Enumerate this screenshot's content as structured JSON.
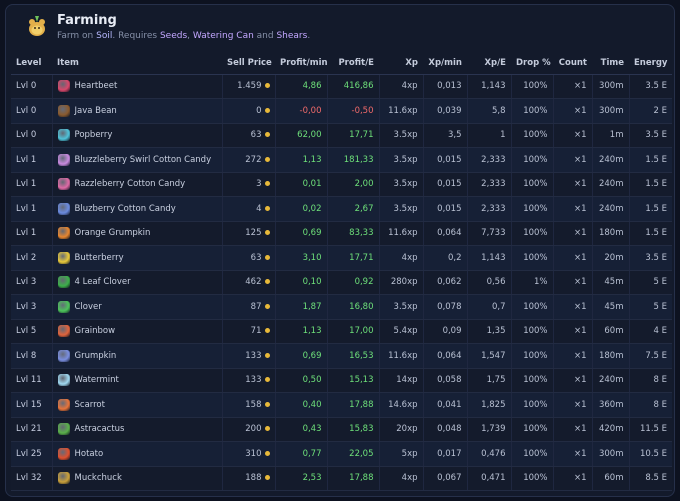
{
  "header": {
    "title": "Farming",
    "subtitle_prefix": "Farm on ",
    "subtitle_location": "Soil",
    "subtitle_requires": ". Requires ",
    "req_1": "Seeds",
    "sep_1": ", ",
    "req_2": "Watering Can",
    "sep_2": " and ",
    "req_3": "Shears",
    "subtitle_end": "."
  },
  "columns": {
    "level": "Level",
    "item": "Item",
    "sell_price": "Sell Price",
    "profit_min": "Profit/min",
    "profit_e": "Profit/E",
    "xp": "Xp",
    "xp_min": "Xp/min",
    "xp_e": "Xp/E",
    "drop": "Drop %",
    "count": "Count",
    "time": "Time",
    "energy": "Energy"
  },
  "rows": [
    {
      "level": "Lvl 0",
      "item": "Heartbeet",
      "icon_color": "#d9476b",
      "sell_price": "1.459",
      "profit_min": "4,86",
      "profit_e": "416,86",
      "xp": "4xp",
      "xp_min": "0,013",
      "xp_e": "1,143",
      "drop": "100%",
      "count": "×1",
      "time": "300m",
      "energy": "3.5 E",
      "profit_sign": "pos"
    },
    {
      "level": "Lvl 0",
      "item": "Java Bean",
      "icon_color": "#8a5a2e",
      "sell_price": "0",
      "profit_min": "-0,00",
      "profit_e": "-0,50",
      "xp": "11.6xp",
      "xp_min": "0,039",
      "xp_e": "5,8",
      "drop": "100%",
      "count": "×1",
      "time": "300m",
      "energy": "2 E",
      "profit_sign": "neg"
    },
    {
      "level": "Lvl 0",
      "item": "Popberry",
      "icon_color": "#4fc3d9",
      "sell_price": "63",
      "profit_min": "62,00",
      "profit_e": "17,71",
      "xp": "3.5xp",
      "xp_min": "3,5",
      "xp_e": "1",
      "drop": "100%",
      "count": "×1",
      "time": "1m",
      "energy": "3.5 E",
      "profit_sign": "pos"
    },
    {
      "level": "Lvl 1",
      "item": "Bluzzleberry Swirl Cotton Candy",
      "icon_color": "#c98ae0",
      "sell_price": "272",
      "profit_min": "1,13",
      "profit_e": "181,33",
      "xp": "3.5xp",
      "xp_min": "0,015",
      "xp_e": "2,333",
      "drop": "100%",
      "count": "×1",
      "time": "240m",
      "energy": "1.5 E",
      "profit_sign": "pos"
    },
    {
      "level": "Lvl 1",
      "item": "Razzleberry Cotton Candy",
      "icon_color": "#e06aa6",
      "sell_price": "3",
      "profit_min": "0,01",
      "profit_e": "2,00",
      "xp": "3.5xp",
      "xp_min": "0,015",
      "xp_e": "2,333",
      "drop": "100%",
      "count": "×1",
      "time": "240m",
      "energy": "1.5 E",
      "profit_sign": "pos"
    },
    {
      "level": "Lvl 1",
      "item": "Bluzberry Cotton Candy",
      "icon_color": "#6b8be0",
      "sell_price": "4",
      "profit_min": "0,02",
      "profit_e": "2,67",
      "xp": "3.5xp",
      "xp_min": "0,015",
      "xp_e": "2,333",
      "drop": "100%",
      "count": "×1",
      "time": "240m",
      "energy": "1.5 E",
      "profit_sign": "pos"
    },
    {
      "level": "Lvl 1",
      "item": "Orange Grumpkin",
      "icon_color": "#e8862e",
      "sell_price": "125",
      "profit_min": "0,69",
      "profit_e": "83,33",
      "xp": "11.6xp",
      "xp_min": "0,064",
      "xp_e": "7,733",
      "drop": "100%",
      "count": "×1",
      "time": "180m",
      "energy": "1.5 E",
      "profit_sign": "pos"
    },
    {
      "level": "Lvl 2",
      "item": "Butterberry",
      "icon_color": "#e8c93a",
      "sell_price": "63",
      "profit_min": "3,10",
      "profit_e": "17,71",
      "xp": "4xp",
      "xp_min": "0,2",
      "xp_e": "1,143",
      "drop": "100%",
      "count": "×1",
      "time": "20m",
      "energy": "3.5 E",
      "profit_sign": "pos"
    },
    {
      "level": "Lvl 3",
      "item": "4 Leaf Clover",
      "icon_color": "#3cb04a",
      "sell_price": "462",
      "profit_min": "0,10",
      "profit_e": "0,92",
      "xp": "280xp",
      "xp_min": "0,062",
      "xp_e": "0,56",
      "drop": "1%",
      "count": "×1",
      "time": "45m",
      "energy": "5 E",
      "profit_sign": "pos"
    },
    {
      "level": "Lvl 3",
      "item": "Clover",
      "icon_color": "#4cc45a",
      "sell_price": "87",
      "profit_min": "1,87",
      "profit_e": "16,80",
      "xp": "3.5xp",
      "xp_min": "0,078",
      "xp_e": "0,7",
      "drop": "100%",
      "count": "×1",
      "time": "45m",
      "energy": "5 E",
      "profit_sign": "pos"
    },
    {
      "level": "Lvl 5",
      "item": "Grainbow",
      "icon_color": "#e0643c",
      "sell_price": "71",
      "profit_min": "1,13",
      "profit_e": "17,00",
      "xp": "5.4xp",
      "xp_min": "0,09",
      "xp_e": "1,35",
      "drop": "100%",
      "count": "×1",
      "time": "60m",
      "energy": "4 E",
      "profit_sign": "pos"
    },
    {
      "level": "Lvl 8",
      "item": "Grumpkin",
      "icon_color": "#7a8ee0",
      "sell_price": "133",
      "profit_min": "0,69",
      "profit_e": "16,53",
      "xp": "11.6xp",
      "xp_min": "0,064",
      "xp_e": "1,547",
      "drop": "100%",
      "count": "×1",
      "time": "180m",
      "energy": "7.5 E",
      "profit_sign": "pos"
    },
    {
      "level": "Lvl 11",
      "item": "Watermint",
      "icon_color": "#9fd8f0",
      "sell_price": "133",
      "profit_min": "0,50",
      "profit_e": "15,13",
      "xp": "14xp",
      "xp_min": "0,058",
      "xp_e": "1,75",
      "drop": "100%",
      "count": "×1",
      "time": "240m",
      "energy": "8 E",
      "profit_sign": "pos"
    },
    {
      "level": "Lvl 15",
      "item": "Scarrot",
      "icon_color": "#e8743a",
      "sell_price": "158",
      "profit_min": "0,40",
      "profit_e": "17,88",
      "xp": "14.6xp",
      "xp_min": "0,041",
      "xp_e": "1,825",
      "drop": "100%",
      "count": "×1",
      "time": "360m",
      "energy": "8 E",
      "profit_sign": "pos"
    },
    {
      "level": "Lvl 21",
      "item": "Astracactus",
      "icon_color": "#5ab04a",
      "sell_price": "200",
      "profit_min": "0,43",
      "profit_e": "15,83",
      "xp": "20xp",
      "xp_min": "0,048",
      "xp_e": "1,739",
      "drop": "100%",
      "count": "×1",
      "time": "420m",
      "energy": "11.5 E",
      "profit_sign": "pos"
    },
    {
      "level": "Lvl 25",
      "item": "Hotato",
      "icon_color": "#e0502e",
      "sell_price": "310",
      "profit_min": "0,77",
      "profit_e": "22,05",
      "xp": "5xp",
      "xp_min": "0,017",
      "xp_e": "0,476",
      "drop": "100%",
      "count": "×1",
      "time": "300m",
      "energy": "10.5 E",
      "profit_sign": "pos"
    },
    {
      "level": "Lvl 32",
      "item": "Muckchuck",
      "icon_color": "#c9a03a",
      "sell_price": "188",
      "profit_min": "2,53",
      "profit_e": "17,88",
      "xp": "4xp",
      "xp_min": "0,067",
      "xp_e": "0,471",
      "drop": "100%",
      "count": "×1",
      "time": "60m",
      "energy": "8.5 E",
      "profit_sign": "pos"
    }
  ]
}
